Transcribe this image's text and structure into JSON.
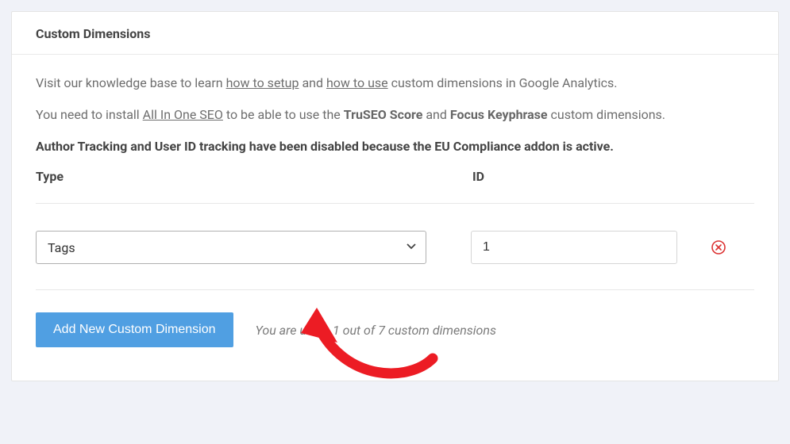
{
  "card": {
    "title": "Custom Dimensions"
  },
  "intro": {
    "line1_prefix": "Visit our knowledge base to learn ",
    "link_setup": "how to setup",
    "line1_mid": " and ",
    "link_use": "how to use",
    "line1_suffix": " custom dimensions in Google Analytics.",
    "line2_prefix": "You need to install ",
    "link_aioseo": "All In One SEO",
    "line2_mid": " to be able to use the ",
    "strong_truseo": "TruSEO Score",
    "line2_and": " and ",
    "strong_focus": "Focus Keyphrase",
    "line2_suffix": " custom dimensions.",
    "warning": "Author Tracking and User ID tracking have been disabled because the EU Compliance addon is active."
  },
  "table": {
    "header_type": "Type",
    "header_id": "ID"
  },
  "rows": [
    {
      "type": "Tags",
      "id": "1"
    }
  ],
  "footer": {
    "add_label": "Add New Custom Dimension",
    "usage": "You are using 1 out of 7 custom dimensions"
  },
  "colors": {
    "accent": "#509fe2",
    "danger": "#dc3232"
  }
}
